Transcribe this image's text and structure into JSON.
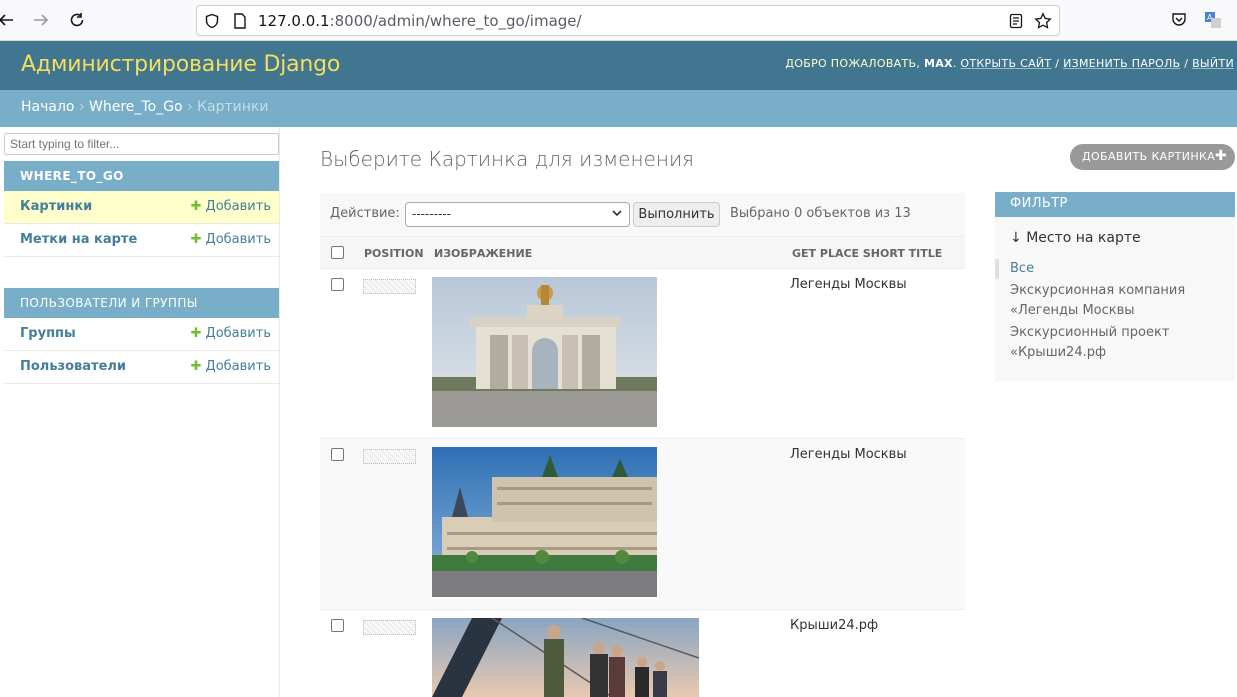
{
  "browser": {
    "url_prefix": "127.0.0.1",
    "url_rest": ":8000/admin/where_to_go/image/"
  },
  "header": {
    "branding": "Администрирование Django",
    "welcome": "Добро пожаловать,",
    "username": "MAX",
    "view_site": "Открыть сайт",
    "change_password": "Изменить пароль",
    "logout": "Выйти"
  },
  "breadcrumbs": {
    "home": "Начало",
    "app": "Where_To_Go",
    "current": "Картинки"
  },
  "sidebar": {
    "filter_placeholder": "Start typing to filter...",
    "apps": [
      {
        "caption": "Where_To_Go",
        "models": [
          {
            "name": "Картинки",
            "add": "Добавить"
          },
          {
            "name": "Метки на карте",
            "add": "Добавить"
          }
        ]
      },
      {
        "caption": "Пользователи и группы",
        "models": [
          {
            "name": "Группы",
            "add": "Добавить"
          },
          {
            "name": "Пользователи",
            "add": "Добавить"
          }
        ]
      }
    ]
  },
  "content": {
    "title": "Выберите Картинка для изменения",
    "add_button": "Добавить Картинка",
    "actions_label": "Действие:",
    "action_selected": "---------",
    "go_button": "Выполнить",
    "selection_count": "Выбрано 0 объектов из 13",
    "columns": [
      "Position",
      "Изображение",
      "Get place short title"
    ],
    "rows": [
      {
        "title": "Легенды Москвы"
      },
      {
        "title": "Легенды Москвы"
      },
      {
        "title": "Крыши24.рф"
      }
    ]
  },
  "filter": {
    "caption": "Фильтр",
    "heading": "Место на карте",
    "options": [
      "Все",
      "Экскурсионная компания «Легенды Москвы",
      "Экскурсионный проект «Крыши24.рф"
    ]
  },
  "colors": {
    "header_bg": "#417690",
    "branding": "#f5dd5d",
    "breadcrumbs_bg": "#79aec8",
    "link": "#447e9b",
    "add_plus": "#70bf2b"
  }
}
